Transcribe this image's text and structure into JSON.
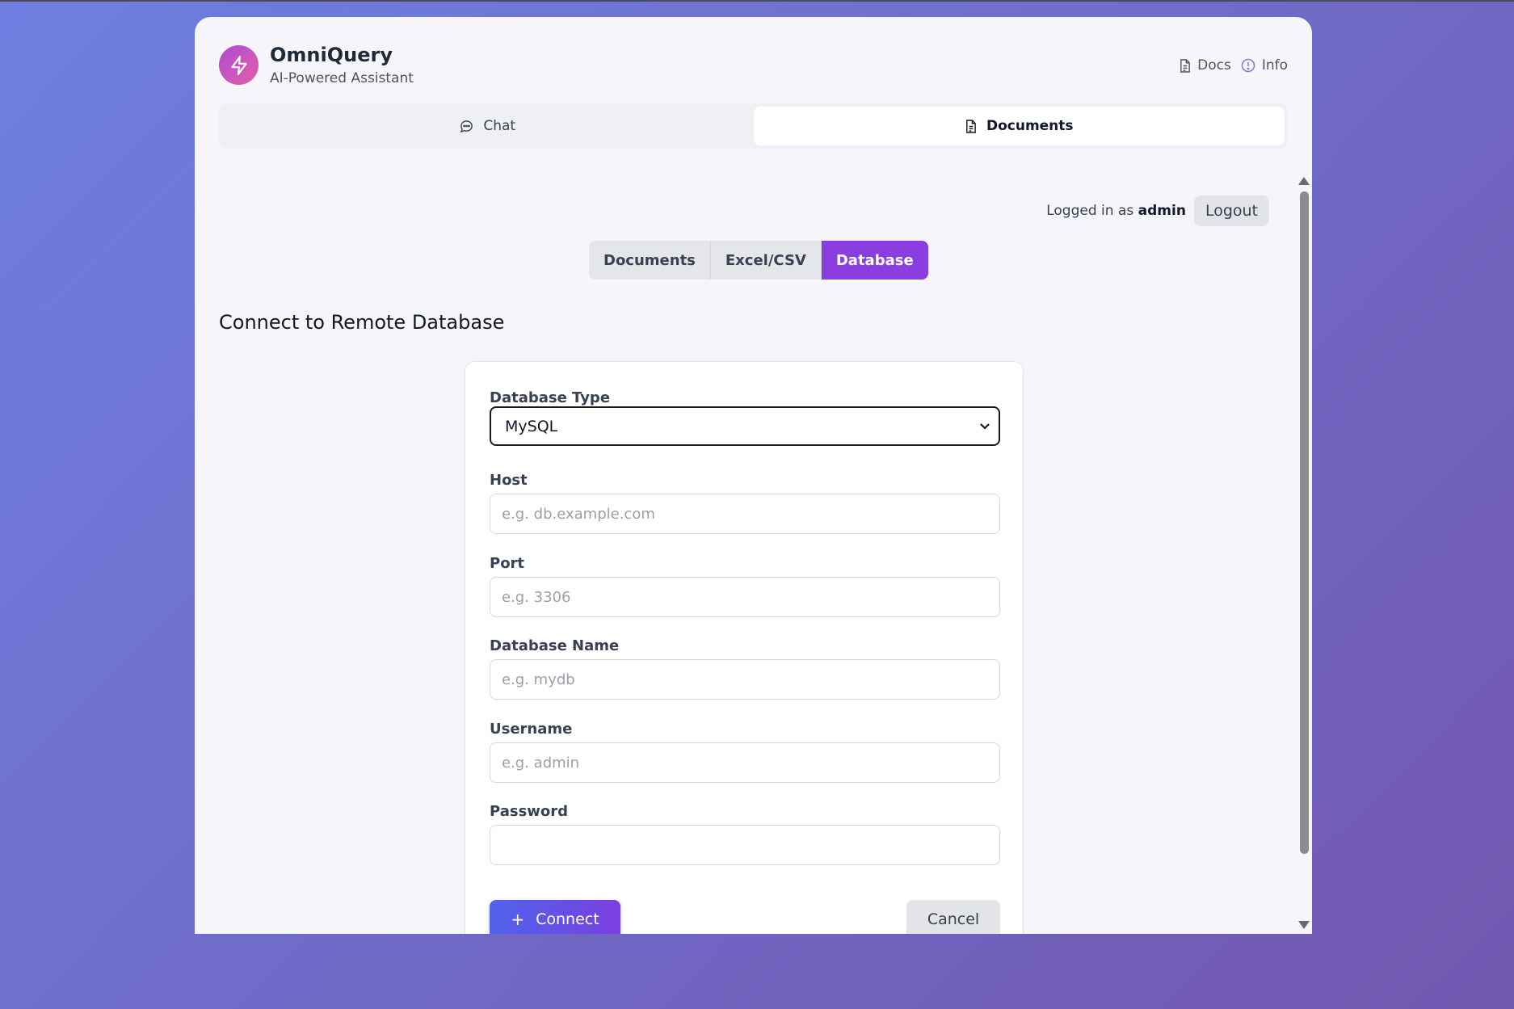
{
  "app": {
    "name": "OmniQuery",
    "subtitle": "AI-Powered Assistant",
    "logo_icon": "lightning-bolt-icon"
  },
  "header_links": [
    {
      "label": "Docs",
      "icon": "document-icon"
    },
    {
      "label": "Info",
      "icon": "info-icon"
    }
  ],
  "main_tabs": [
    {
      "label": "Chat",
      "icon": "chat-bubble-icon",
      "active": false
    },
    {
      "label": "Documents",
      "icon": "document-icon",
      "active": true
    }
  ],
  "session": {
    "prefix": "Logged in as",
    "username": "admin",
    "logout_label": "Logout"
  },
  "sub_tabs": [
    {
      "label": "Documents",
      "active": false
    },
    {
      "label": "Excel/CSV",
      "active": false
    },
    {
      "label": "Database",
      "active": true
    }
  ],
  "section_title": "Connect to Remote Database",
  "form": {
    "db_type": {
      "label": "Database Type",
      "value": "MySQL"
    },
    "host": {
      "label": "Host",
      "placeholder": "e.g. db.example.com",
      "value": ""
    },
    "port": {
      "label": "Port",
      "placeholder": "e.g. 3306",
      "value": ""
    },
    "db_name": {
      "label": "Database Name",
      "placeholder": "e.g. mydb",
      "value": ""
    },
    "username": {
      "label": "Username",
      "placeholder": "e.g. admin",
      "value": ""
    },
    "password": {
      "label": "Password",
      "placeholder": "",
      "value": ""
    },
    "connect_label": "Connect",
    "cancel_label": "Cancel"
  },
  "colors": {
    "accent_purple": "#8a3ee0",
    "connect_gradient_start": "#4f63ec",
    "connect_gradient_end": "#7b3fe0",
    "background_start": "#6e7fe0",
    "background_end": "#7257b0"
  }
}
